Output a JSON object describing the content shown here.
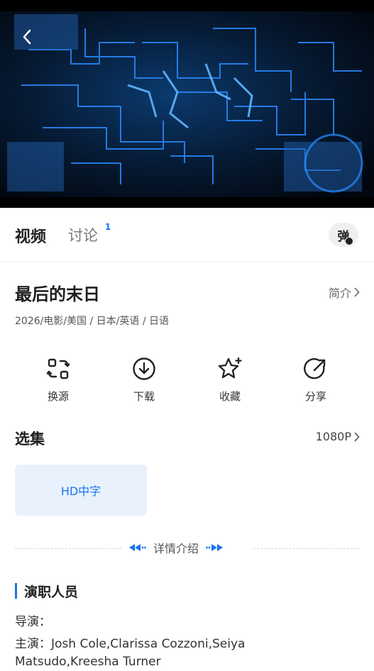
{
  "player": {
    "back_icon": "chevron-left-icon"
  },
  "tabs": {
    "video": "视频",
    "discuss": "讨论",
    "discuss_badge": "1",
    "danmaku": "弹"
  },
  "movie": {
    "title": "最后的末日",
    "intro_link": "简介",
    "meta": "2026/电影/美国 / 日本/英语 / 日语"
  },
  "actions": [
    {
      "label": "换源",
      "icon": "switch-source-icon"
    },
    {
      "label": "下载",
      "icon": "download-icon"
    },
    {
      "label": "收藏",
      "icon": "star-icon"
    },
    {
      "label": "分享",
      "icon": "share-icon"
    }
  ],
  "episodes": {
    "title": "选集",
    "quality": "1080P",
    "items": [
      "HD中字"
    ]
  },
  "details": {
    "label": "详情介绍"
  },
  "cast": {
    "title": "演职人员",
    "director": "导演：",
    "starring": "主演：Josh Cole,Clarissa Cozzoni,Seiya Matsudo,Kreesha Turner"
  },
  "colors": {
    "accent": "#1a73e8",
    "episode_bg": "#e8f1fc"
  }
}
